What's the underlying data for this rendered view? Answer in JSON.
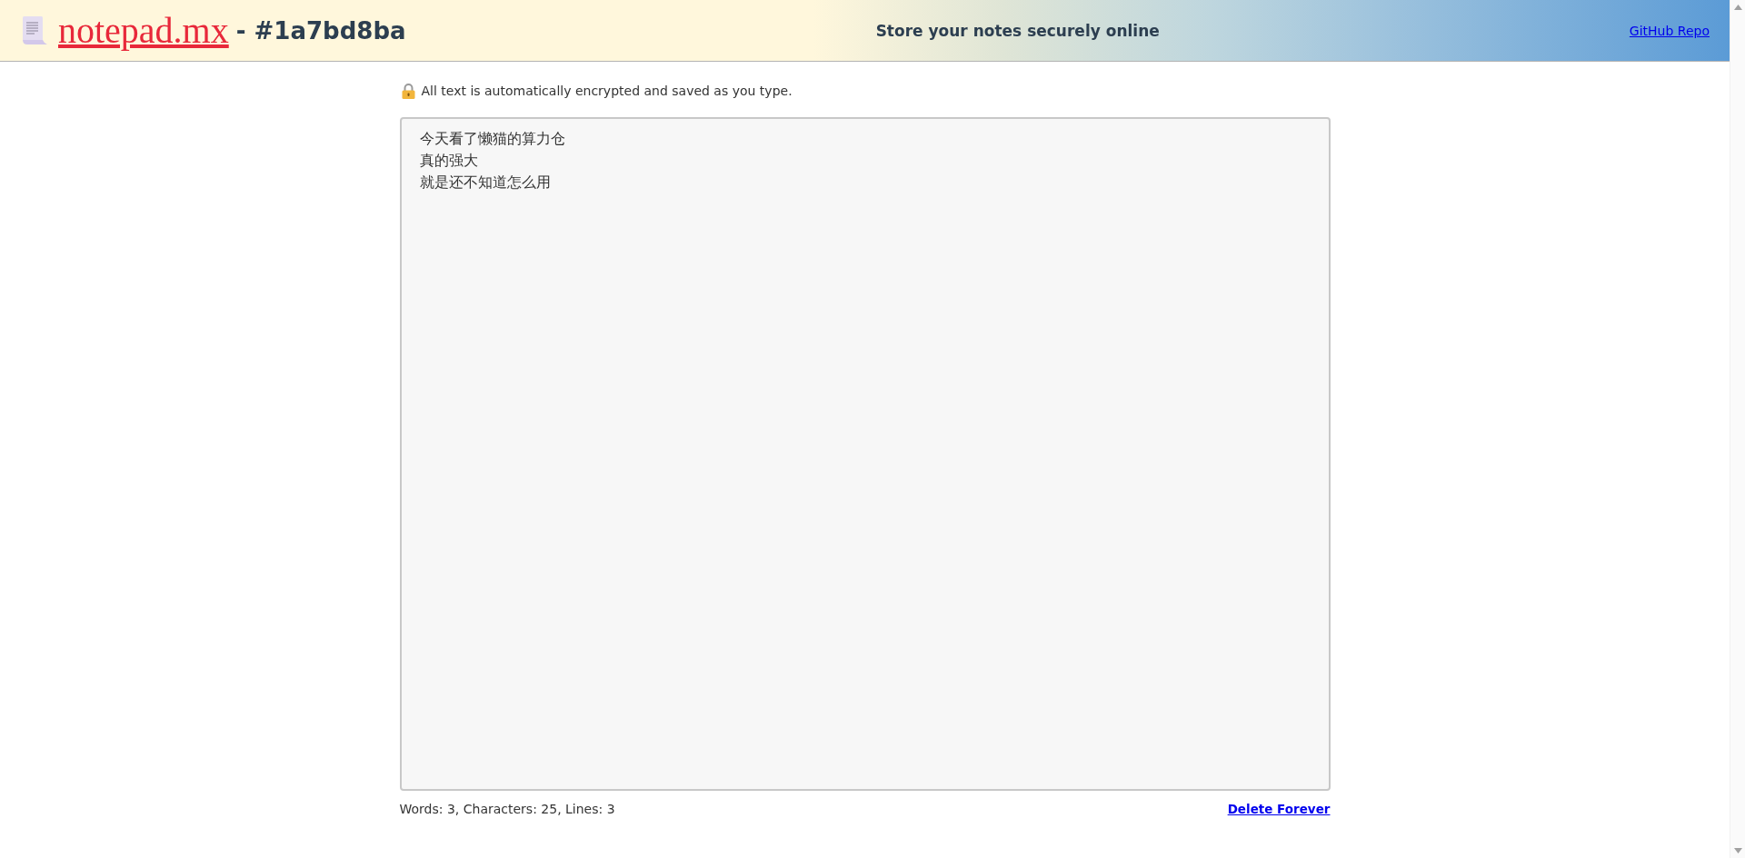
{
  "header": {
    "site_name": "notepad.mx",
    "note_id": "- #1a7bd8ba",
    "tagline": "Store your notes securely online",
    "link": "GitHub Repo"
  },
  "notice": "All text is automatically encrypted and saved as you type.",
  "editor": {
    "lines": [
      "今天看了懒猫的算力仓",
      "真的强大",
      "就是还不知道怎么用"
    ]
  },
  "footer": {
    "stats": "Words: 3, Characters: 25, Lines: 3",
    "delete_link": "Delete Forever"
  }
}
